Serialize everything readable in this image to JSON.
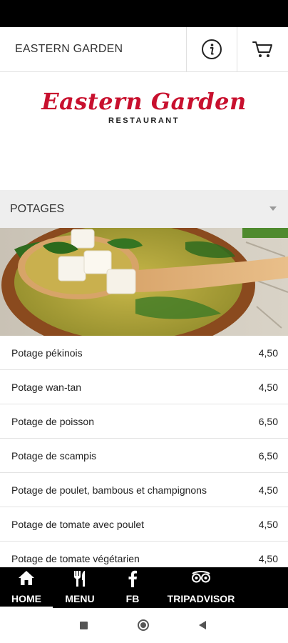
{
  "topbar": {
    "title": "EASTERN GARDEN",
    "info_icon": "info-icon",
    "cart_icon": "cart-icon"
  },
  "logo": {
    "name": "Eastern Garden",
    "subtitle": "RESTAURANT"
  },
  "section": {
    "label": "POTAGES",
    "dropdown_icon": "caret-down-icon"
  },
  "items": [
    {
      "name": "Potage pékinois",
      "price": "4,50"
    },
    {
      "name": "Potage wan-tan",
      "price": "4,50"
    },
    {
      "name": "Potage de poisson",
      "price": "6,50"
    },
    {
      "name": "Potage de scampis",
      "price": "6,50"
    },
    {
      "name": "Potage de poulet, bambous et champignons",
      "price": "4,50"
    },
    {
      "name": "Potage de tomate avec poulet",
      "price": "4,50"
    },
    {
      "name": "Potage de tomate végétarien",
      "price": "4,50"
    }
  ],
  "bottomnav": [
    {
      "label": "HOME",
      "icon": "home-icon",
      "active": true
    },
    {
      "label": "MENU",
      "icon": "utensils-icon"
    },
    {
      "label": "FB",
      "icon": "facebook-icon"
    },
    {
      "label": "TRIPADVISOR",
      "icon": "tripadvisor-icon"
    }
  ],
  "colors": {
    "brand": "#c8102e",
    "nav_bg": "#000000",
    "section_bg": "#eeeeee"
  }
}
